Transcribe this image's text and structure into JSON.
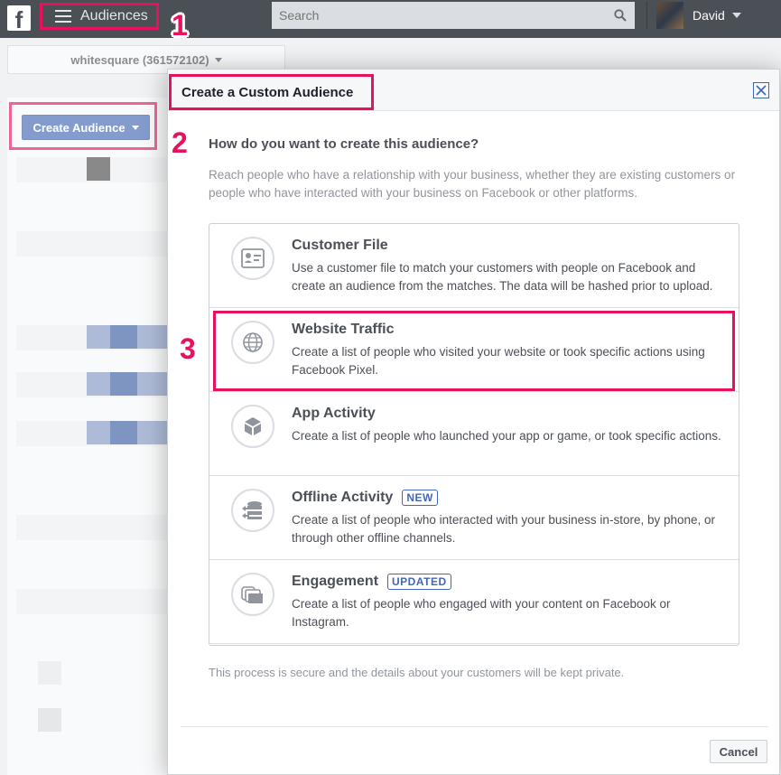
{
  "topbar": {
    "logo": "f",
    "menu_label": "Audiences",
    "search_placeholder": "Search",
    "user_name": "David"
  },
  "account": {
    "label": "whitesquare (361572102)"
  },
  "sidebar": {
    "create_label": "Create Audience"
  },
  "dialog": {
    "title": "Create a Custom Audience",
    "question": "How do you want to create this audience?",
    "intro": "Reach people who have a relationship with your business, whether they are existing customers or people who have interacted with your business on Facebook or other platforms.",
    "options": [
      {
        "title": "Customer File",
        "badge": "",
        "description": "Use a customer file to match your customers with people on Facebook and create an audience from the matches. The data will be hashed prior to upload.",
        "icon": "contact-card-icon"
      },
      {
        "title": "Website Traffic",
        "badge": "",
        "description": "Create a list of people who visited your website or took specific actions using Facebook Pixel.",
        "icon": "globe-icon"
      },
      {
        "title": "App Activity",
        "badge": "",
        "description": "Create a list of people who launched your app or game, or took specific actions.",
        "icon": "cube-icon"
      },
      {
        "title": "Offline Activity",
        "badge": "NEW",
        "description": "Create a list of people who interacted with your business in-store, by phone, or through other offline channels.",
        "icon": "offline-store-icon"
      },
      {
        "title": "Engagement",
        "badge": "UPDATED",
        "description": "Create a list of people who engaged with your content on Facebook or Instagram.",
        "icon": "engagement-icon"
      }
    ],
    "privacy_note": "This process is secure and the details about your customers will be kept private.",
    "cancel_label": "Cancel"
  },
  "annotations": {
    "step1": "1",
    "step2": "2",
    "step3": "3"
  },
  "colors": {
    "topbar": "#4b4f56",
    "primary": "#4267b2",
    "highlight": "#e6125f"
  }
}
